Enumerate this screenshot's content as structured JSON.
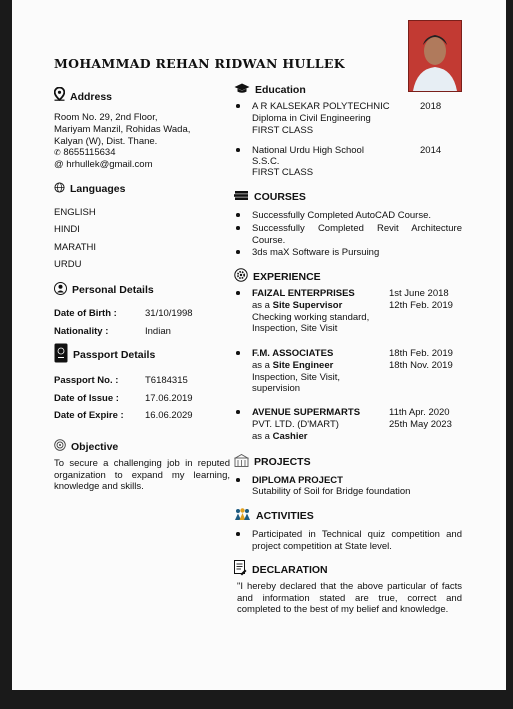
{
  "name": "MOHAMMAD REHAN RIDWAN HULLEK",
  "address": {
    "heading": "Address",
    "lines": [
      "Room No. 29, 2nd Floor,",
      "Mariyam Manzil, Rohidas Wada,",
      "Kalyan (W), Dist. Thane."
    ],
    "phone": "8655115634",
    "email": "hrhullek@gmail.com"
  },
  "languages": {
    "heading": "Languages",
    "items": [
      "ENGLISH",
      "HINDI",
      "MARATHI",
      "URDU"
    ]
  },
  "personal": {
    "heading": "Personal Details",
    "dob_label": "Date of Birth :",
    "dob": "31/10/1998",
    "nationality_label": "Nationality   :",
    "nationality": "Indian"
  },
  "passport": {
    "heading": "Passport Details",
    "no_label": "Passport No.  :",
    "no": "T6184315",
    "issue_label": "Date of Issue  :",
    "issue": "17.06.2019",
    "expire_label": "Date of Expire :",
    "expire": "16.06.2029"
  },
  "objective": {
    "heading": "Objective",
    "text": "To secure a challenging job in reputed organization to expand my learning, knowledge and skills."
  },
  "education": {
    "heading": "Education",
    "items": [
      {
        "inst": "A R KALSEKAR POLYTECHNIC",
        "year": "2018",
        "line2": "Diploma in Civil Engineering",
        "line3": "FIRST CLASS"
      },
      {
        "inst": "National Urdu High School",
        "year": "2014",
        "line2": "S.S.C.",
        "line3": "FIRST CLASS"
      }
    ]
  },
  "courses": {
    "heading": "COURSES",
    "items": [
      "Successfully Completed AutoCAD Course.",
      "Successfully Completed Revit Architecture Course.",
      "3ds maX Software is Pursuing"
    ]
  },
  "experience": {
    "heading": "EXPERIENCE",
    "items": [
      {
        "company": "FAIZAL ENTERPRISES",
        "role_prefix": "as a ",
        "role": "Site Supervisor",
        "duties": [
          "Checking working standard,",
          "Inspection,  Site Visit"
        ],
        "from": "1st June 2018",
        "to": "12th Feb. 2019"
      },
      {
        "company": "F.M. ASSOCIATES",
        "role_prefix": "as a ",
        "role": "Site Engineer",
        "duties": [
          "Inspection, Site Visit,",
          "supervision"
        ],
        "from": "18th Feb. 2019",
        "to": "18th Nov. 2019"
      },
      {
        "company": "AVENUE SUPERMARTS",
        "company2": "PVT. LTD. (D'MART)",
        "role_prefix": "as a ",
        "role": "Cashier",
        "duties": [],
        "from": "11th Apr. 2020",
        "to": "25th May 2023"
      }
    ]
  },
  "projects": {
    "heading": "PROJECTS",
    "title": "DIPLOMA PROJECT",
    "desc": "Sutability of Soil for Bridge foundation"
  },
  "activities": {
    "heading": "ACTIVITIES",
    "text": "Participated in Technical quiz competition and project competition at State level."
  },
  "declaration": {
    "heading": "DECLARATION",
    "text": "\"I hereby declared that the above particular of facts and information stated are true, correct and completed to the best of my belief and knowledge."
  },
  "icons": [
    "location-pin-icon",
    "globe-icon",
    "person-icon",
    "passport-icon",
    "target-icon",
    "graduation-cap-icon",
    "books-icon",
    "gear-icon",
    "building-icon",
    "people-icon",
    "document-icon",
    "phone-icon",
    "at-icon"
  ],
  "colors": {
    "paper": "#fbfbfb",
    "background": "#1a1a1a",
    "photo": "#b5362f"
  }
}
